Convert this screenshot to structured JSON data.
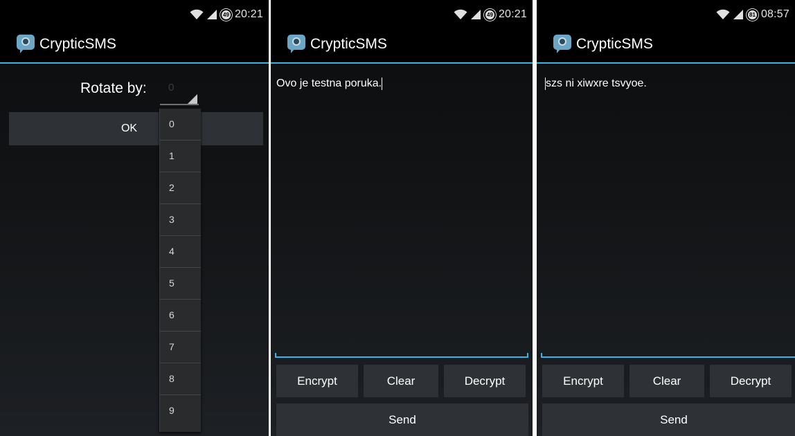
{
  "panels": {
    "rotate": {
      "status_time": "20:21",
      "battery": "49",
      "app_title": "CrypticSMS",
      "rotate_label": "Rotate by:",
      "selected_value": "0",
      "ok_label": "OK",
      "options": [
        "0",
        "1",
        "2",
        "3",
        "4",
        "5",
        "6",
        "7",
        "8",
        "9"
      ]
    },
    "compose": {
      "status_time": "20:21",
      "battery": "49",
      "app_title": "CrypticSMS",
      "message": "Ovo je testna poruka.",
      "encrypt_label": "Encrypt",
      "clear_label": "Clear",
      "decrypt_label": "Decrypt",
      "send_label": "Send"
    },
    "encrypted": {
      "status_time": "08:57",
      "battery": "81",
      "app_title": "CrypticSMS",
      "message": "szs ni xiwxre tsvyoe.",
      "encrypt_label": "Encrypt",
      "clear_label": "Clear",
      "decrypt_label": "Decrypt",
      "send_label": "Send"
    }
  },
  "colors": {
    "accent": "#33b5e5",
    "button_bg": "#2e3236",
    "icon_blue": "#6ba7c5"
  },
  "icons": [
    "wifi-icon",
    "signal-icon",
    "battery-icon",
    "app-icon"
  ]
}
